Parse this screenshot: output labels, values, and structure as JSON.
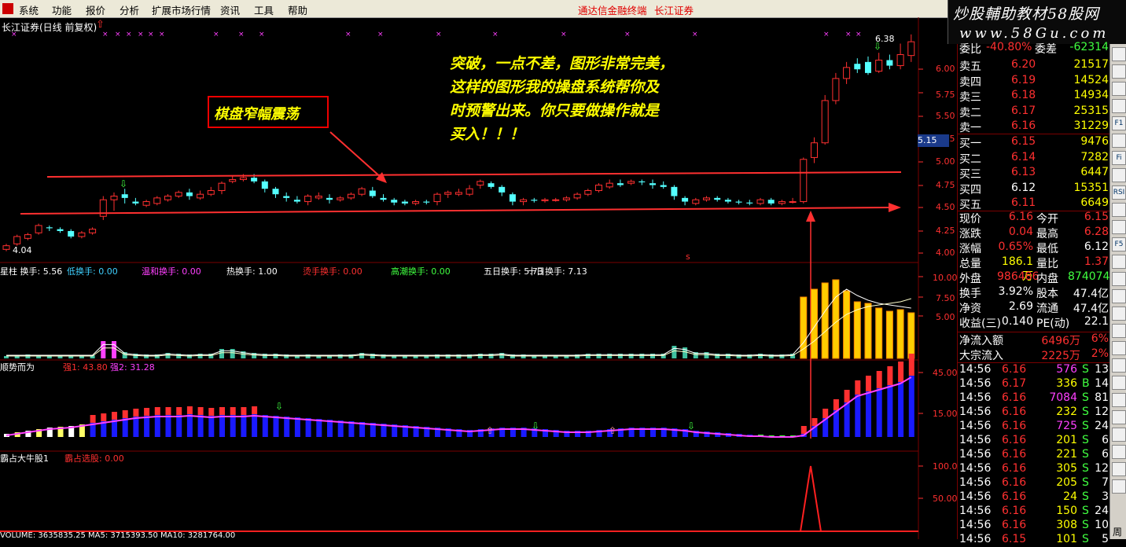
{
  "menu": [
    "系统",
    "功能",
    "报价",
    "分析",
    "扩展市场行情",
    "资讯",
    "工具",
    "帮助"
  ],
  "menu_right": [
    "通达信金融终端",
    "长江证券"
  ],
  "brand": {
    "line1": "炒股輔助教材58股网",
    "line2": "www.58Gu.com"
  },
  "chart": {
    "title": "长江证券(日线 前复权)",
    "price_ticks": [
      "6.00",
      "5.75",
      "5.50",
      "5.25",
      "5.00",
      "4.75",
      "4.50",
      "4.25",
      "4.00"
    ],
    "current_price_tag": "5.15",
    "high_label": "6.38",
    "low_label": "4.04",
    "annotation_box": "棋盘窄幅震荡",
    "annotation_text": [
      "突破，一点不差，图形非常完美，",
      "这样的图形我的操盘系统帮你及",
      "时预警出来。你只要做操作就是",
      "买入！！！"
    ],
    "signal_mark": "s"
  },
  "sub1": {
    "labels": [
      {
        "text": "星柱 换手: 5.56",
        "color": "#ffffff"
      },
      {
        "text": "低换手: 0.00",
        "color": "#3fd0ff"
      },
      {
        "text": "温和换手: 0.00",
        "color": "#ff40ff"
      },
      {
        "text": "热换手: 1.00",
        "color": "#ffffff"
      },
      {
        "text": "烫手换手: 0.00",
        "color": "#ff3030"
      },
      {
        "text": "高潮换手: 0.00",
        "color": "#40ff40"
      },
      {
        "text": "五日换手: 5.73",
        "color": "#ffffff"
      },
      {
        "text": "十日换手: 7.13",
        "color": "#ffffff"
      }
    ],
    "ticks": [
      "10.00",
      "7.50",
      "5.00"
    ]
  },
  "sub2": {
    "labels": [
      {
        "text": "顺势而为",
        "color": "#ffffff"
      },
      {
        "text": "强1: 43.80",
        "color": "#ff3030"
      },
      {
        "text": "强2: 31.28",
        "color": "#ff40ff"
      }
    ],
    "ticks": [
      "45.00",
      "15.00"
    ]
  },
  "sub3": {
    "labels": [
      {
        "text": "霸占大牛股1",
        "color": "#ffffff"
      },
      {
        "text": "霸占选股: 0.00",
        "color": "#ff3030"
      }
    ],
    "ticks": [
      "100.0",
      "50.00"
    ]
  },
  "volume_line": "VOLUME: 3635835.25  MA5: 3715393.50  MA10: 3281764.00",
  "quote": {
    "wb_row": {
      "label": "委比",
      "value": "-40.80%",
      "label2": "委差",
      "value2": "-62314"
    },
    "sell": [
      {
        "label": "卖五",
        "price": "6.20",
        "vol": "21517"
      },
      {
        "label": "卖四",
        "price": "6.19",
        "vol": "14524"
      },
      {
        "label": "卖三",
        "price": "6.18",
        "vol": "14934"
      },
      {
        "label": "卖二",
        "price": "6.17",
        "vol": "25315"
      },
      {
        "label": "卖一",
        "price": "6.16",
        "vol": "31229"
      }
    ],
    "buy": [
      {
        "label": "买一",
        "price": "6.15",
        "vol": "9476"
      },
      {
        "label": "买二",
        "price": "6.14",
        "vol": "7282"
      },
      {
        "label": "买三",
        "price": "6.13",
        "vol": "6447"
      },
      {
        "label": "买四",
        "price": "6.12",
        "vol": "15351"
      },
      {
        "label": "买五",
        "price": "6.11",
        "vol": "6649"
      }
    ],
    "stats": [
      {
        "l1": "现价",
        "v1": "6.16",
        "l2": "今开",
        "v2": "6.15",
        "c1": "#ff3030",
        "c2": "#ff3030"
      },
      {
        "l1": "涨跌",
        "v1": "0.04",
        "l2": "最高",
        "v2": "6.28",
        "c1": "#ff3030",
        "c2": "#ff3030"
      },
      {
        "l1": "涨幅",
        "v1": "0.65%",
        "l2": "最低",
        "v2": "6.12",
        "c1": "#ff3030",
        "c2": "#ffffff"
      },
      {
        "l1": "总量",
        "v1": "186.1万",
        "l2": "量比",
        "v2": "1.37",
        "c1": "#ffff00",
        "c2": "#ff3030"
      },
      {
        "l1": "外盘",
        "v1": "986486",
        "l2": "内盘",
        "v2": "874074",
        "c1": "#ff3030",
        "c2": "#40ff40"
      },
      {
        "l1": "换手",
        "v1": "3.92%",
        "l2": "股本",
        "v2": "47.4亿",
        "c1": "#ffffff",
        "c2": "#ffffff"
      },
      {
        "l1": "净资",
        "v1": "2.69",
        "l2": "流通",
        "v2": "47.4亿",
        "c1": "#ffffff",
        "c2": "#ffffff"
      },
      {
        "l1": "收益(三)",
        "v1": "0.140",
        "l2": "PE(动)",
        "v2": "22.1",
        "c1": "#ffffff",
        "c2": "#ffffff"
      }
    ],
    "flows": [
      {
        "label": "净流入额",
        "value": "6496万",
        "pct": "6%"
      },
      {
        "label": "大宗流入",
        "value": "2225万",
        "pct": "2%"
      }
    ],
    "ticks": [
      {
        "t": "14:56",
        "p": "6.16",
        "v": "576",
        "d": "S",
        "n": "13",
        "vc": "#ff40ff"
      },
      {
        "t": "14:56",
        "p": "6.17",
        "v": "336",
        "d": "B",
        "n": "14",
        "vc": "#ffff00"
      },
      {
        "t": "14:56",
        "p": "6.16",
        "v": "7084",
        "d": "S",
        "n": "81",
        "vc": "#ff40ff"
      },
      {
        "t": "14:56",
        "p": "6.16",
        "v": "232",
        "d": "S",
        "n": "12",
        "vc": "#ffff00"
      },
      {
        "t": "14:56",
        "p": "6.16",
        "v": "725",
        "d": "S",
        "n": "24",
        "vc": "#ff40ff"
      },
      {
        "t": "14:56",
        "p": "6.16",
        "v": "201",
        "d": "S",
        "n": "6",
        "vc": "#ffff00"
      },
      {
        "t": "14:56",
        "p": "6.16",
        "v": "221",
        "d": "S",
        "n": "6",
        "vc": "#ffff00"
      },
      {
        "t": "14:56",
        "p": "6.16",
        "v": "305",
        "d": "S",
        "n": "12",
        "vc": "#ffff00"
      },
      {
        "t": "14:56",
        "p": "6.16",
        "v": "205",
        "d": "S",
        "n": "7",
        "vc": "#ffff00"
      },
      {
        "t": "14:56",
        "p": "6.16",
        "v": "24",
        "d": "S",
        "n": "3",
        "vc": "#ffff00"
      },
      {
        "t": "14:56",
        "p": "6.16",
        "v": "150",
        "d": "S",
        "n": "24",
        "vc": "#ffff00"
      },
      {
        "t": "14:56",
        "p": "6.16",
        "v": "308",
        "d": "S",
        "n": "10",
        "vc": "#ffff00"
      },
      {
        "t": "14:56",
        "p": "6.15",
        "v": "101",
        "d": "S",
        "n": "5",
        "vc": "#ffff00"
      }
    ]
  },
  "toolbar": [
    "F1",
    "Fi",
    "RSI",
    "F5",
    "周"
  ],
  "colors": {
    "up": "#ff3030",
    "down": "#54ffff",
    "grid": "#7a0000",
    "accent": "#ffff00"
  }
}
